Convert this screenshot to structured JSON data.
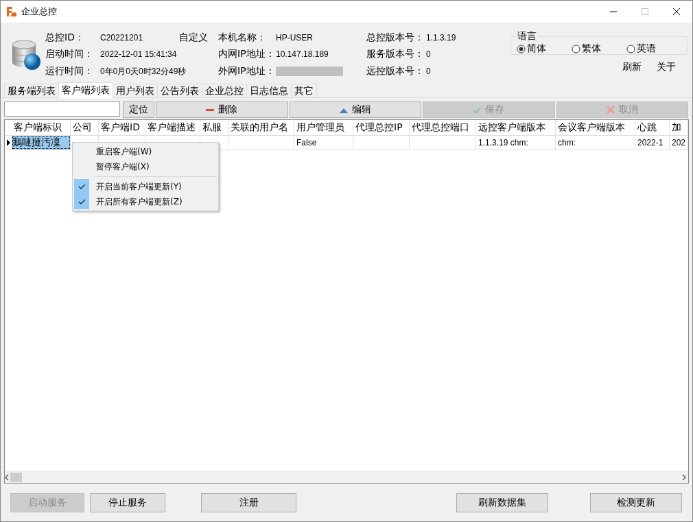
{
  "window": {
    "title": "企业总控"
  },
  "info": {
    "columns": [
      {
        "fields": [
          {
            "label": "总控ID：",
            "value": "C20221201",
            "kind": "text"
          },
          {
            "label": "启动时间：",
            "value": "2022-12-01 15:41:34",
            "kind": "text"
          },
          {
            "label": "运行时间：",
            "value": "0年0月0天0时32分49秒",
            "kind": "text"
          }
        ]
      },
      {
        "fields": [
          {
            "label": "本机名称：",
            "value": "HP-USER",
            "kind": "text"
          },
          {
            "label": "内网IP地址：",
            "value": "10.147.18.189",
            "kind": "text"
          },
          {
            "label": "外网IP地址：",
            "kind": "masked"
          }
        ]
      },
      {
        "fields": [
          {
            "label": "总控版本号：",
            "value": "1.1.3.19",
            "kind": "text"
          },
          {
            "label": "服务版本号：",
            "value": "0",
            "kind": "text"
          },
          {
            "label": "远控版本号：",
            "value": "0",
            "kind": "text"
          }
        ]
      }
    ],
    "custom_button": "自定义"
  },
  "language": {
    "title": "语言",
    "options": [
      {
        "label": "简体",
        "selected": true
      },
      {
        "label": "繁体",
        "selected": false
      },
      {
        "label": "英语",
        "selected": false
      }
    ]
  },
  "header_links": [
    "刷新",
    "关于"
  ],
  "tabs": [
    {
      "label": "服务端列表",
      "selected": false
    },
    {
      "label": "客户端列表",
      "selected": true
    },
    {
      "label": "用户列表",
      "selected": false
    },
    {
      "label": "公告列表",
      "selected": false
    },
    {
      "label": "企业总控",
      "selected": false
    },
    {
      "label": "日志信息",
      "selected": false
    },
    {
      "label": "其它",
      "selected": false
    }
  ],
  "toolbar": {
    "buttons": [
      {
        "label": "定位",
        "kind": "plain",
        "disabled": false
      },
      {
        "label": "删除",
        "kind": "delete",
        "disabled": false
      },
      {
        "label": "编辑",
        "kind": "edit",
        "disabled": false
      },
      {
        "label": "保存",
        "kind": "save",
        "disabled": true
      },
      {
        "label": "取消",
        "kind": "cancel",
        "disabled": true
      }
    ]
  },
  "table": {
    "columns": [
      "客户端标识",
      "公司",
      "客户端ID",
      "客户端描述",
      "私服",
      "关联的用户名",
      "用户管理员",
      "代理总控IP",
      "代理总控端口",
      "远控客户端版本",
      "会议客户端版本",
      "心跳",
      "加"
    ],
    "rows": [
      {
        "current": true,
        "cells": [
          {
            "text": "鵝嗹摙汚凜",
            "selected": true
          },
          {
            "selected": false
          },
          {
            "selected": false
          },
          {
            "selected": false
          },
          {
            "selected": false
          },
          {
            "selected": false
          },
          {
            "text": "False",
            "selected": false
          },
          {
            "selected": false
          },
          {
            "selected": false
          },
          {
            "text": "1.1.3.19 chm:",
            "selected": false
          },
          {
            "text": "chm:",
            "selected": false
          },
          {
            "text": "2022-1",
            "selected": false
          },
          {
            "text": "202",
            "selected": false
          }
        ]
      }
    ]
  },
  "context_menu": {
    "items": [
      {
        "kind": "item",
        "label": "重启客户端(W)",
        "checked": false
      },
      {
        "kind": "item",
        "label": "暂停客户端(X)",
        "checked": false
      },
      {
        "kind": "separator"
      },
      {
        "kind": "item",
        "label": "开启当前客户端更新(Y)",
        "checked": true
      },
      {
        "kind": "item",
        "label": "开启所有客户端更新(Z)",
        "checked": true
      }
    ]
  },
  "footer": {
    "buttons": [
      {
        "label": "启动服务",
        "disabled": true
      },
      {
        "label": "停止服务",
        "disabled": false
      },
      {
        "label": "注册",
        "disabled": false
      },
      {
        "label": "刷新数据集",
        "disabled": false
      },
      {
        "label": "检测更新",
        "disabled": false
      }
    ]
  }
}
